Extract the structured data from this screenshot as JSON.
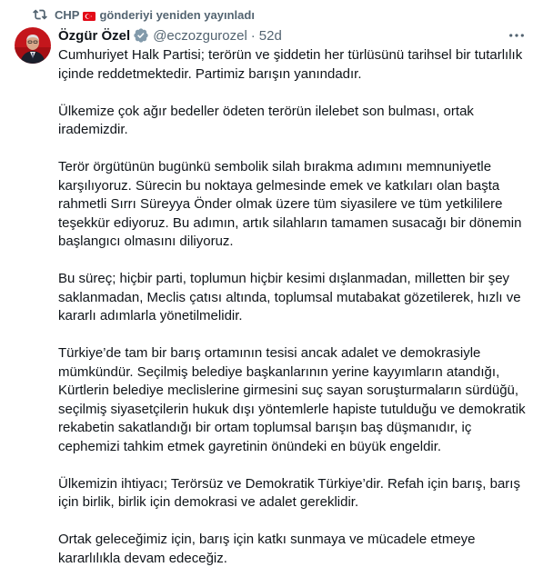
{
  "repost": {
    "account": "CHP",
    "action": "gönderiyi yeniden yayınladı",
    "icon": "repost-icon",
    "flag": "turkey-flag-icon"
  },
  "tweet": {
    "display_name": "Özgür Özel",
    "handle": "@eczozgurozel",
    "separator": "·",
    "time": "52d",
    "verified_color": "#1d9bf0",
    "paragraphs": [
      "Cumhuriyet Halk Partisi; terörün ve şiddetin her türlüsünü tarihsel bir tutarlılık içinde reddetmektedir. Partimiz barışın yanındadır.",
      "Ülkemize çok ağır bedeller ödeten terörün ilelebet son bulması, ortak irademizdir.",
      "Terör örgütünün bugünkü sembolik silah bırakma adımını memnuniyetle karşılıyoruz. Sürecin bu noktaya gelmesinde emek ve katkıları olan başta rahmetli Sırrı Süreyya Önder olmak üzere tüm siyasilere ve tüm yetkililere teşekkür ediyoruz. Bu adımın, artık silahların tamamen susacağı bir dönemin başlangıcı olmasını diliyoruz.",
      "Bu süreç; hiçbir parti, toplumun hiçbir kesimi dışlanmadan, milletten bir şey saklanmadan, Meclis çatısı altında, toplumsal mutabakat gözetilerek, hızlı ve kararlı adımlarla yönetilmelidir.",
      "Türkiye’de tam bir barış ortamının tesisi ancak adalet ve demokrasiyle mümkündür. Seçilmiş belediye başkanlarının yerine kayyımların atandığı, Kürtlerin belediye meclislerine girmesini suç sayan soruşturmaların sürdüğü, seçilmiş siyasetçilerin hukuk dışı yöntemlerle hapiste tutulduğu ve demokratik rekabetin sakatlandığı bir ortam toplumsal barışın baş düşmanıdır, iç cephemizi tahkim etmek gayretinin önündeki en büyük engeldir.",
      "Ülkemizin ihtiyacı; Terörsüz ve Demokratik Türkiye’dir. Refah için barış, barış için birlik, birlik için demokrasi ve adalet gereklidir.",
      "Ortak geleceğimiz için, barış için katkı sunmaya ve mücadele etmeye kararlılıkla devam edeceğiz."
    ]
  }
}
